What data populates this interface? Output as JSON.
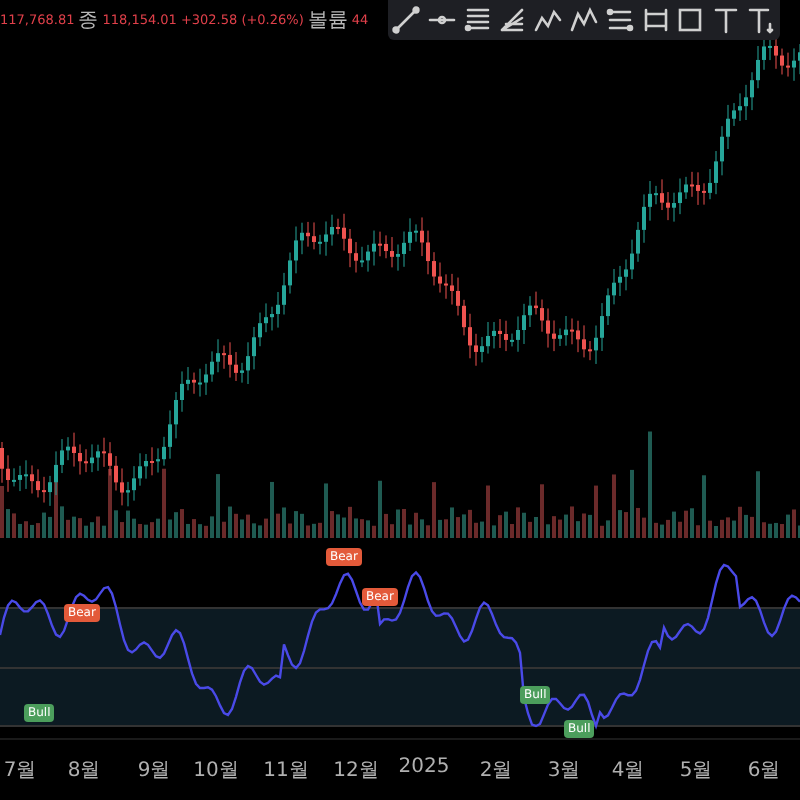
{
  "legend": {
    "value": "117,768.81",
    "close_label": "종",
    "close": "118,154.01",
    "change": "+302.58 (+0.26%)",
    "volume_label": "볼륨",
    "volume": "44"
  },
  "signals": [
    {
      "kind": "bear",
      "label": "Bear"
    },
    {
      "kind": "bear",
      "label": "Bear"
    },
    {
      "kind": "bear",
      "label": "Bear"
    },
    {
      "kind": "bull",
      "label": "Bull"
    },
    {
      "kind": "bull",
      "label": "Bull"
    },
    {
      "kind": "bull",
      "label": "Bull"
    }
  ],
  "time_axis": [
    "7월",
    "8월",
    "9월",
    "10월",
    "11월",
    "12월",
    "2025",
    "2월",
    "3월",
    "4월",
    "5월",
    "6월"
  ]
}
